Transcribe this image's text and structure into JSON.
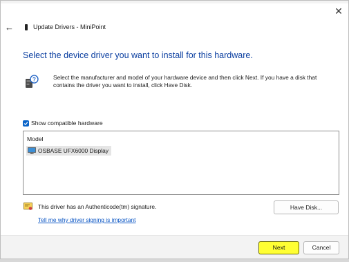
{
  "window": {
    "title": "Update Drivers - MiniPoint",
    "close_icon": "close-icon",
    "back_icon": "back-arrow-icon"
  },
  "heading": "Select the device driver you want to install for this hardware.",
  "instructions": "Select the manufacturer and model of your hardware device and then click Next. If you have a disk that contains the driver you want to install, click Have Disk.",
  "show_compatible": {
    "label": "Show compatible hardware",
    "checked": true
  },
  "model_list": {
    "header": "Model",
    "items": [
      {
        "label": "OSBASE UFX6000 Display",
        "selected": true
      }
    ]
  },
  "signature": {
    "text": "This driver has an Authenticode(tm) signature.",
    "link": "Tell me why driver signing is important"
  },
  "buttons": {
    "have_disk": "Have Disk...",
    "next": "Next",
    "cancel": "Cancel"
  },
  "colors": {
    "heading": "#0a3ea0",
    "link": "#0a55c4",
    "checkbox": "#0a64c9",
    "next_highlight": "#ffff33"
  }
}
